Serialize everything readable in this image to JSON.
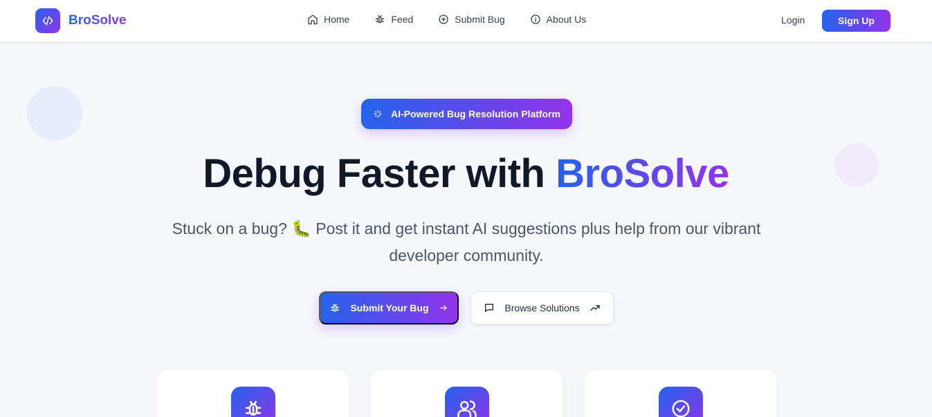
{
  "app": {
    "name": "BroSolve"
  },
  "nav": {
    "items": [
      {
        "label": "Home",
        "icon": "home-icon"
      },
      {
        "label": "Feed",
        "icon": "bug-icon"
      },
      {
        "label": "Submit Bug",
        "icon": "plus-circle-icon"
      },
      {
        "label": "About Us",
        "icon": "info-icon"
      }
    ],
    "login": "Login",
    "signup": "Sign Up"
  },
  "hero": {
    "badge": "AI-Powered Bug Resolution Platform",
    "title_plain": "Debug Faster with ",
    "title_brand": "BroSolve",
    "subtitle": "Stuck on a bug? 🐛 Post it and get instant AI suggestions plus help from our vibrant developer community.",
    "primary_cta": "Submit Your Bug",
    "secondary_cta": "Browse Solutions"
  },
  "features": [
    {
      "icon": "bug-icon"
    },
    {
      "icon": "users-icon"
    },
    {
      "icon": "check-circle-icon"
    }
  ],
  "colors": {
    "gradient_start": "#2563eb",
    "gradient_end": "#9333ea",
    "text": "#111827",
    "muted": "#4b5563"
  }
}
